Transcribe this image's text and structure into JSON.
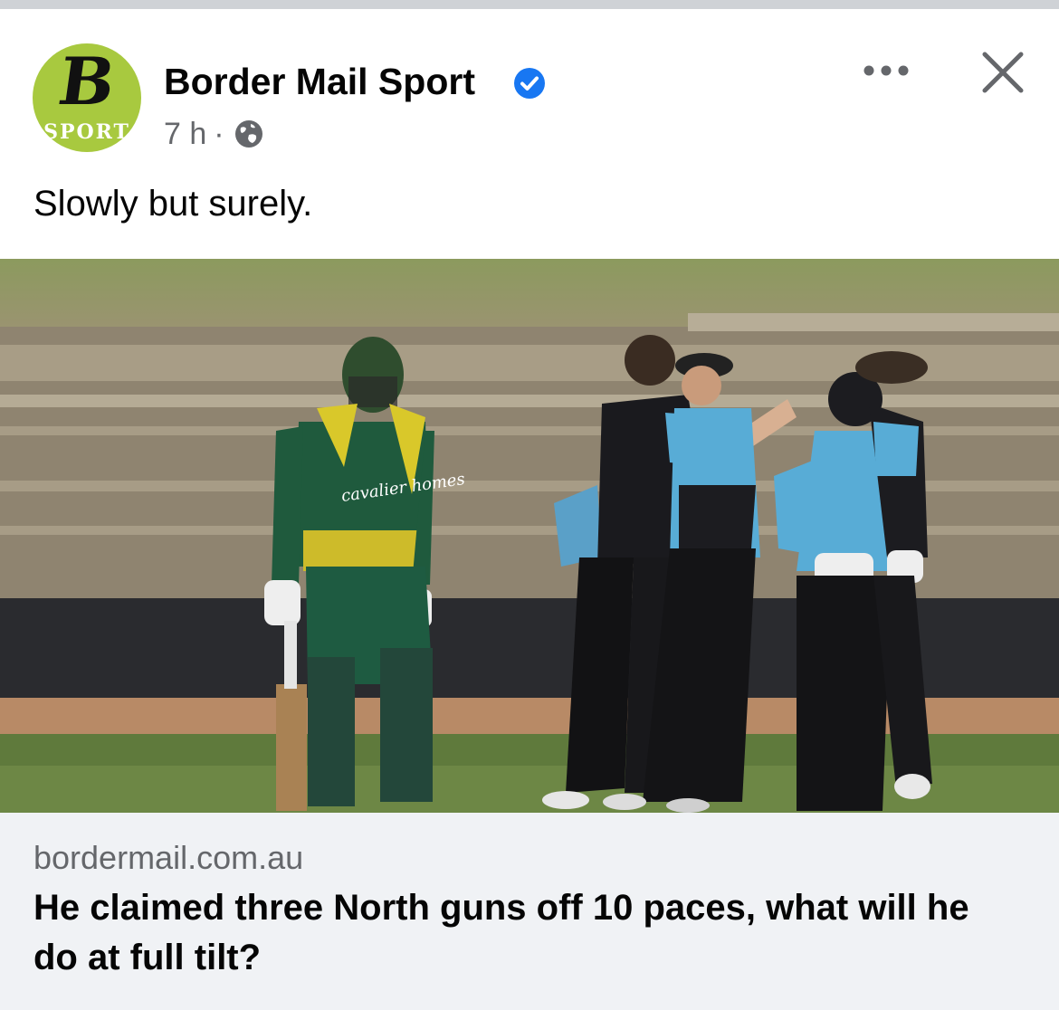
{
  "post": {
    "page_name": "Border Mail Sport",
    "avatar_logo_letter": "B",
    "avatar_logo_text": "SPORT",
    "verified_icon": "verified-badge-icon",
    "time_ago": "7 h",
    "separator": "·",
    "audience_icon": "globe-icon",
    "text": "Slowly but surely."
  },
  "actions": {
    "more_icon": "more-options-icon",
    "close_icon": "close-icon"
  },
  "link_preview": {
    "domain": "bordermail.com.au",
    "headline": "He claimed three North guns off 10 paces, what will he do at full tilt?",
    "image_icon": "cricket-match-photo",
    "jersey_sponsor": "cavalier homes"
  },
  "colors": {
    "verified_blue": "#1877f2",
    "secondary_text": "#65676b",
    "card_background": "#f0f2f5",
    "logo_green": "#a8c93f"
  }
}
